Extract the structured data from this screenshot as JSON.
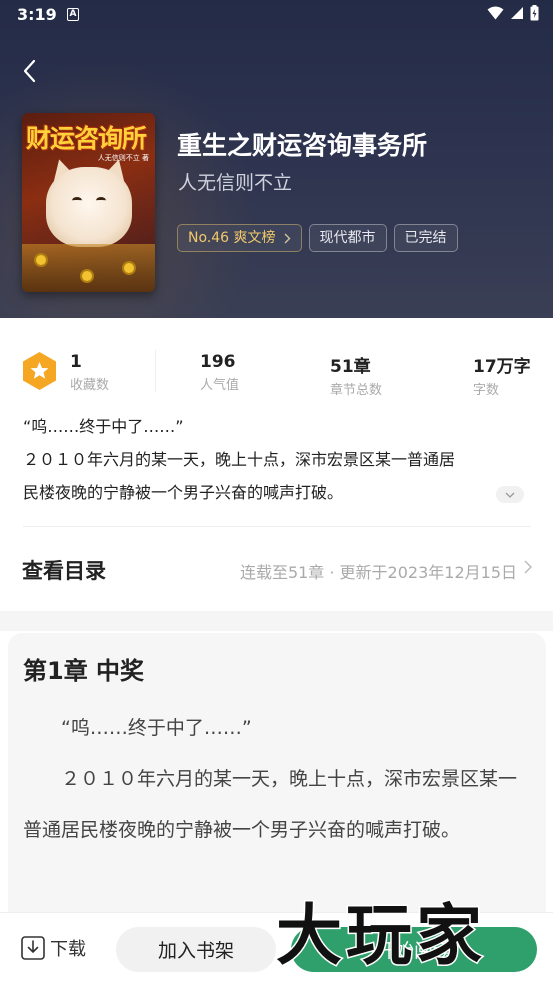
{
  "status_bar": {
    "time": "3:19",
    "notification_badge": "A"
  },
  "book": {
    "cover_title": "财运咨询所",
    "cover_subtitle": "人无信则不立 著",
    "title": "重生之财运咨询事务所",
    "author": "人无信则不立",
    "tags": [
      {
        "label": "No.46 爽文榜",
        "has_chevron": true
      },
      {
        "label": "现代都市",
        "has_chevron": false
      },
      {
        "label": "已完结",
        "has_chevron": false
      }
    ]
  },
  "stats": [
    {
      "value": "1",
      "label": "收藏数"
    },
    {
      "value": "196",
      "label": "人气值"
    },
    {
      "value": "51章",
      "label": "章节总数"
    },
    {
      "value": "17万字",
      "label": "字数"
    }
  ],
  "intro": {
    "line1": "“呜……终于中了……”",
    "line2": "２０１０年六月的某一天，晚上十点，深市宏景区某一普通居",
    "line3": "民楼夜晚的宁静被一个男子兴奋的喊声打破。"
  },
  "toc": {
    "title": "查看目录",
    "info": "连载至51章 · 更新于2023年12月15日"
  },
  "chapter": {
    "title": "第1章 中奖",
    "para1": "“呜……终于中了……”",
    "para2": "２０１０年六月的某一天，晚上十点，深市宏景区某一普通居民楼夜晚的宁静被一个男子兴奋的喊声打破。"
  },
  "bottom_bar": {
    "download_label": "下载",
    "add_shelf_label": "加入书架",
    "read_label": "开始阅读"
  },
  "watermark": "大玩家",
  "colors": {
    "header_bg": "#2a3049",
    "accent_green": "#2fa06b",
    "badge_orange": "#f5a623",
    "rank_gold": "#f0c96a"
  }
}
